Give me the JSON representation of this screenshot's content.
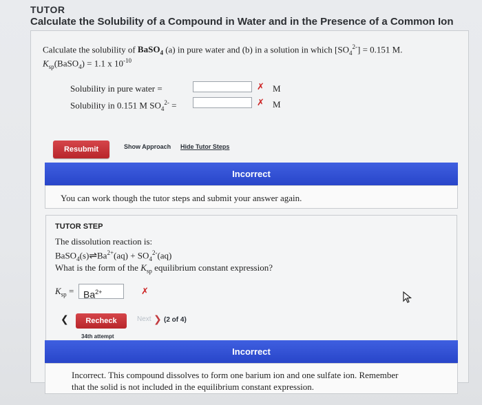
{
  "header": {
    "app": "TUTOR",
    "title": "Calculate the Solubility of a Compound in Water and in the Presence of a Common Ion"
  },
  "problem": {
    "line1_prefix": "Calculate the solubility of ",
    "compound": "BaSO",
    "compound_sub": "4",
    "line1_mid": " (a) in pure water and (b) in a solution in which [SO",
    "ion_sub": "4",
    "ion_sup": "2-",
    "line1_end": "] = 0.151 M.",
    "ksp_label": "K",
    "ksp_sub": "sp",
    "ksp_text": "(BaSO",
    "ksp_text_sub": "4",
    "ksp_value": ") = 1.1 x 10",
    "ksp_exp": "-10"
  },
  "answers": {
    "pure_label": "Solubility in pure water =",
    "pure_value": "",
    "pure_unit": "M",
    "common_label_prefix": "Solubility in 0.151 M SO",
    "common_label_sub": "4",
    "common_label_sup": "2-",
    "common_label_eq": " =",
    "common_value": "",
    "common_unit": "M",
    "mark": "✗"
  },
  "actions": {
    "resubmit": "Resubmit",
    "show_approach": "Show Approach",
    "hide_steps": "Hide Tutor Steps"
  },
  "result1": {
    "banner": "Incorrect",
    "message": "You can work though the tutor steps and submit your answer again."
  },
  "tutor_step": {
    "title": "TUTOR STEP",
    "line1": "The dissolution reaction is:",
    "rx_left": "BaSO",
    "rx_left_sub": "4",
    "rx_left_state": "(s)",
    "rx_arrow": "⇌",
    "rx_ba": "Ba",
    "rx_ba_sup": "2+",
    "rx_ba_state": "(aq) + SO",
    "rx_so4_sub": "4",
    "rx_so4_sup": "2-",
    "rx_so4_state": "(aq)",
    "question_prefix": "What is the form of the ",
    "question_k": "K",
    "question_sub": "sp",
    "question_suffix": " equilibrium constant expression?",
    "ksp_eq_label": "K",
    "ksp_eq_sub": "sp",
    "ksp_eq_sign": " =",
    "ksp_input_value": "Ba",
    "ksp_input_sup": "2+",
    "mark": "✗",
    "back": "❮",
    "recheck": "Recheck",
    "next": "Next",
    "next_chev": "❯",
    "progress": "(2 of 4)",
    "attempt": "34th attempt"
  },
  "result2": {
    "banner": "Incorrect",
    "message_line1": "Incorrect. This compound dissolves to form one barium ion and one sulfate ion. Remember",
    "message_line2": "that the solid is not included in the equilibrium constant expression."
  }
}
